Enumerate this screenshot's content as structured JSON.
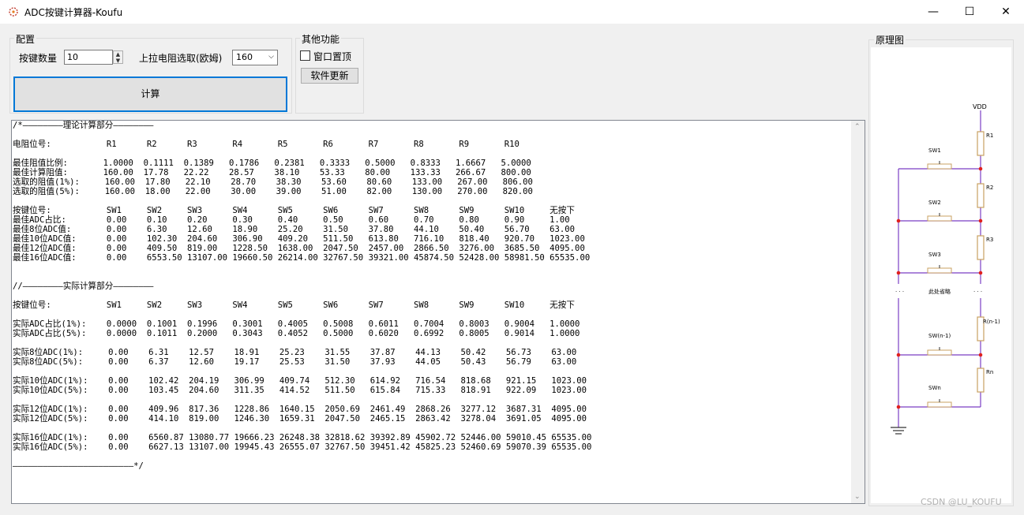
{
  "window": {
    "title": "ADC按键计算器-Koufu",
    "minimize_glyph": "—",
    "maximize_glyph": "☐",
    "close_glyph": "✕"
  },
  "config": {
    "group_label": "配置",
    "key_count_label": "按键数量",
    "key_count_value": "10",
    "pullup_label": "上拉电阻选取(欧姆)",
    "pullup_value": "160",
    "calculate_label": "计算"
  },
  "other": {
    "group_label": "其他功能",
    "topmost_label": "窗口置顶",
    "topmost_checked": false,
    "update_label": "软件更新"
  },
  "result_text": "/*————————理论计算部分————————\n\n电阻位号:           R1      R2      R3       R4       R5       R6       R7       R8       R9       R10\n\n最佳阻值比例:       1.0000  0.1111  0.1389   0.1786   0.2381   0.3333   0.5000   0.8333   1.6667   5.0000\n最佳计算阻值:       160.00  17.78   22.22    28.57    38.10    53.33    80.00    133.33   266.67   800.00\n选取的阻值(1%):     160.00  17.80   22.10    28.70    38.30    53.60    80.60    133.00   267.00   806.00\n选取的阻值(5%):     160.00  18.00   22.00    30.00    39.00    51.00    82.00    130.00   270.00   820.00\n\n按键位号:           SW1     SW2     SW3      SW4      SW5      SW6      SW7      SW8      SW9      SW10     无按下\n最佳ADC占比:        0.00    0.10    0.20     0.30     0.40     0.50     0.60     0.70     0.80     0.90     1.00\n最佳8位ADC值:       0.00    6.30    12.60    18.90    25.20    31.50    37.80    44.10    50.40    56.70    63.00\n最佳10位ADC值:      0.00    102.30  204.60   306.90   409.20   511.50   613.80   716.10   818.40   920.70   1023.00\n最佳12位ADC值:      0.00    409.50  819.00   1228.50  1638.00  2047.50  2457.00  2866.50  3276.00  3685.50  4095.00\n最佳16位ADC值:      0.00    6553.50 13107.00 19660.50 26214.00 32767.50 39321.00 45874.50 52428.00 58981.50 65535.00\n\n\n//————————实际计算部分————————\n\n按键位号:           SW1     SW2     SW3      SW4      SW5      SW6      SW7      SW8      SW9      SW10     无按下\n\n实际ADC占比(1%):    0.0000  0.1001  0.1996   0.3001   0.4005   0.5008   0.6011   0.7004   0.8003   0.9004   1.0000\n实际ADC占比(5%):    0.0000  0.1011  0.2000   0.3043   0.4052   0.5000   0.6020   0.6992   0.8005   0.9014   1.0000\n\n实际8位ADC(1%):     0.00    6.31    12.57    18.91    25.23    31.55    37.87    44.13    50.42    56.73    63.00\n实际8位ADC(5%):     0.00    6.37    12.60    19.17    25.53    31.50    37.93    44.05    50.43    56.79    63.00\n\n实际10位ADC(1%):    0.00    102.42  204.19   306.99   409.74   512.30   614.92   716.54   818.68   921.15   1023.00\n实际10位ADC(5%):    0.00    103.45  204.60   311.35   414.52   511.50   615.84   715.33   818.91   922.09   1023.00\n\n实际12位ADC(1%):    0.00    409.96  817.36   1228.86  1640.15  2050.69  2461.49  2868.26  3277.12  3687.31  4095.00\n实际12位ADC(5%):    0.00    414.10  819.00   1246.30  1659.31  2047.50  2465.15  2863.42  3278.04  3691.05  4095.00\n\n实际16位ADC(1%):    0.00    6560.87 13080.77 19666.23 26248.38 32818.62 39392.89 45902.72 52446.00 59010.45 65535.00\n实际16位ADC(5%):    0.00    6627.13 13107.00 19945.43 26555.07 32767.50 39451.42 45825.23 52460.69 59070.39 65535.00\n\n————————————————————————*/",
  "schematic": {
    "group_label": "原理图",
    "vdd": "VDD",
    "resistors": [
      "R1",
      "R2",
      "R3",
      "R(n-1)",
      "Rn"
    ],
    "switches": [
      "SW1",
      "SW2",
      "SW3",
      "SW(n-1)",
      "SWn"
    ],
    "dots_left": "· · ·",
    "omitted": "此处省略",
    "dots_right": "· · ·"
  },
  "watermark": "CSDN @LU_KOUFU",
  "colors": {
    "accent": "#0078d7",
    "wire": "#7b3fc4",
    "resistor": "#c8a060",
    "node": "#e0201e"
  }
}
